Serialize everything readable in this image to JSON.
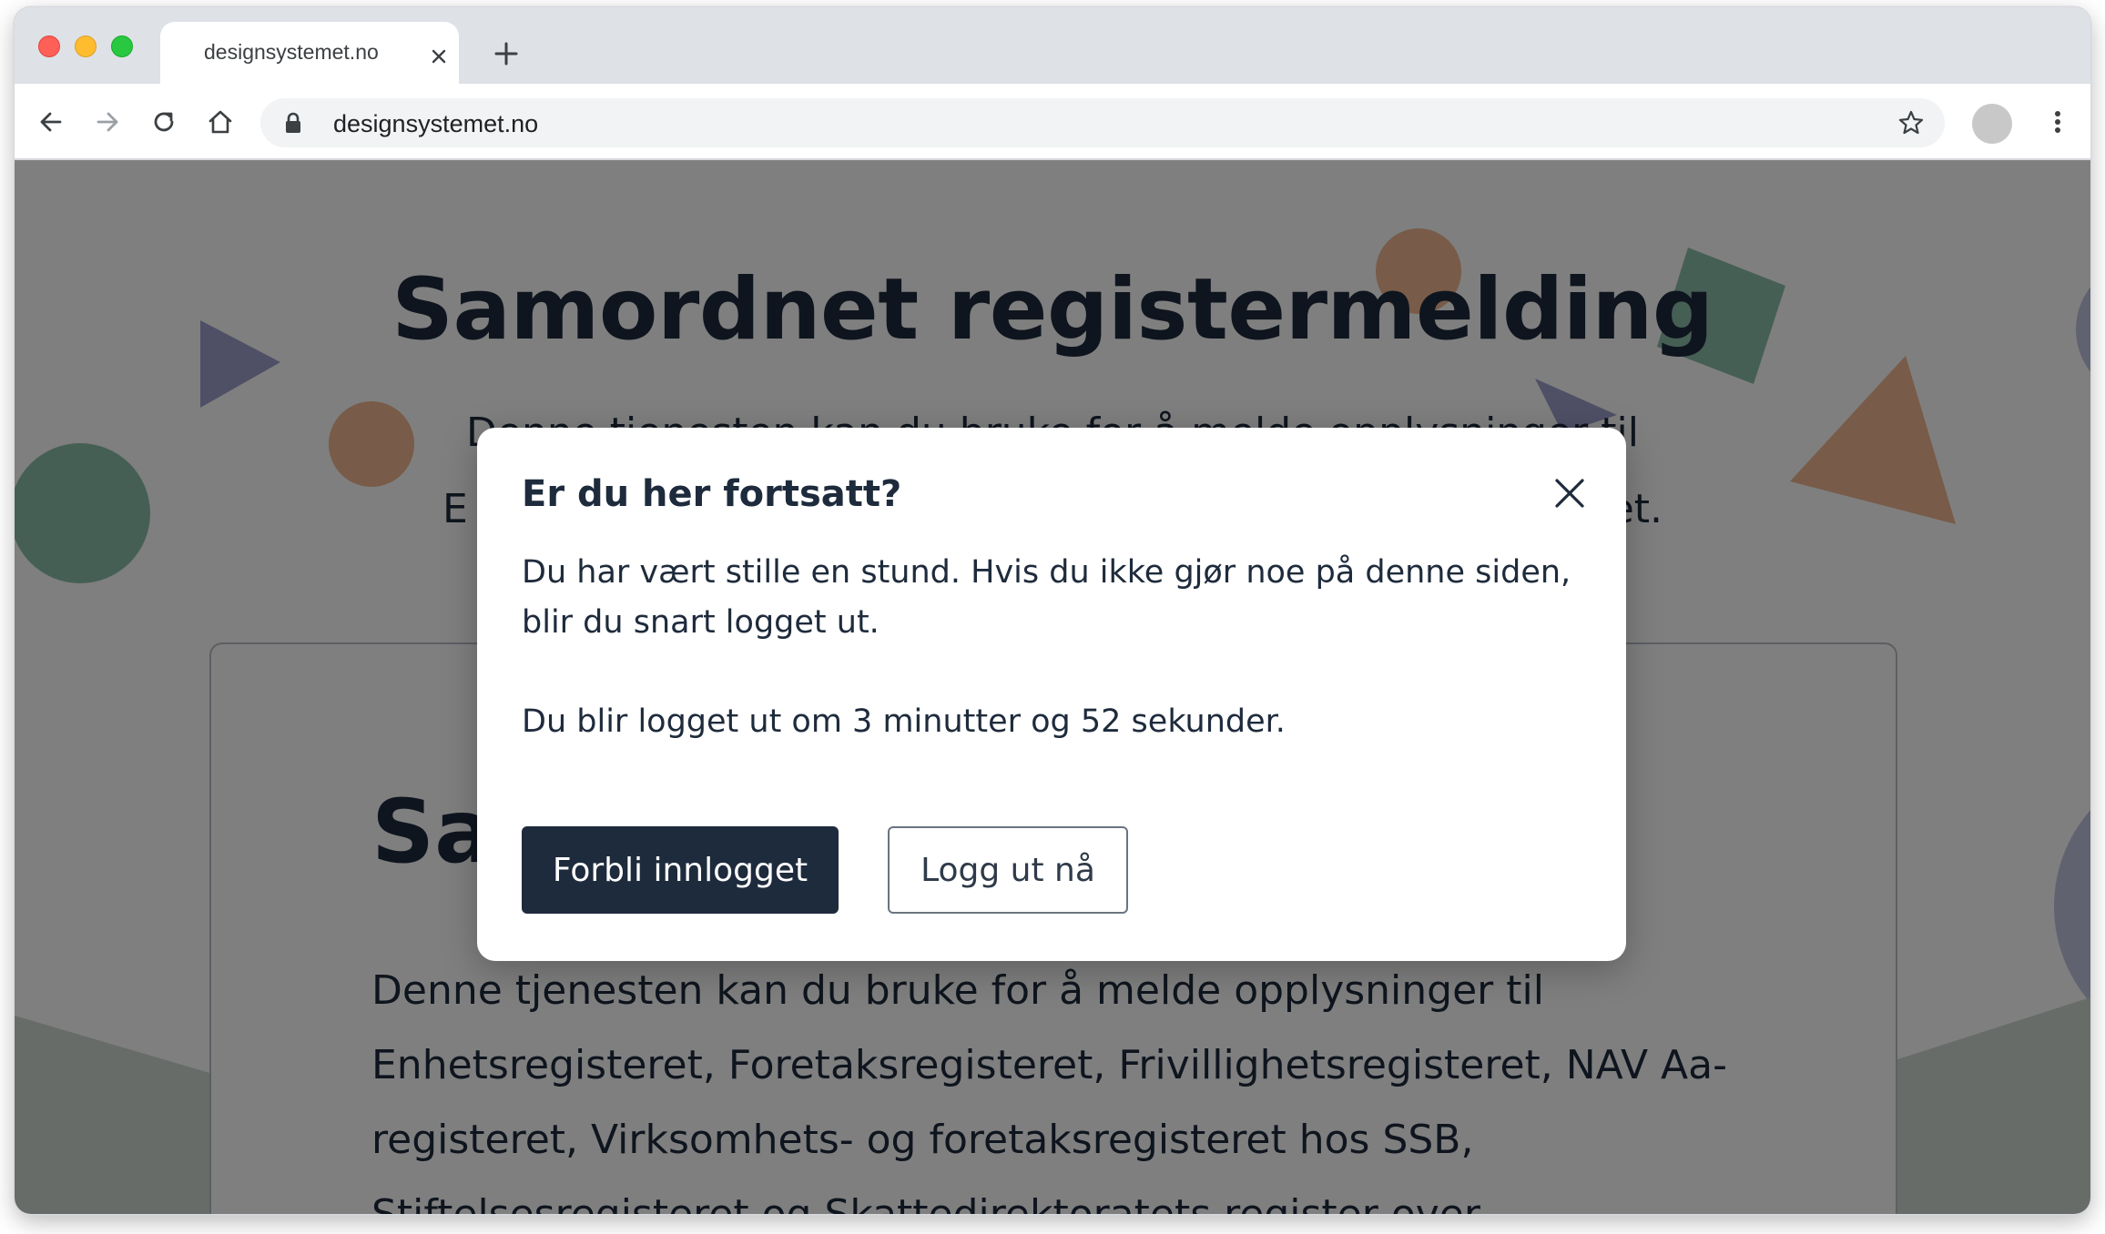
{
  "browser": {
    "tab_title": "designsystemet.no",
    "url": "designsystemet.no"
  },
  "page": {
    "hero_title": "Samordnet registermelding",
    "hero_subtitle_line1": "Denne tjenesten kan du bruke for å melde opplysninger til",
    "hero_subtitle_line2_start": "E",
    "hero_subtitle_line2_end": "et.",
    "card_title": "Sa",
    "card_body": "Denne tjenesten kan du bruke for å melde opplysninger til Enhetsregisteret, Foretaksregisteret, Frivillighetsregisteret, NAV Aa-registeret, Virksomhets- og foretaksregisteret hos SSB, Stiftelsesregisteret og Skattedirektoratets register over"
  },
  "modal": {
    "title": "Er du her fortsatt?",
    "text": "Du har vært stille en stund. Hvis du ikke gjør noe på denne siden, blir du snart logget ut.",
    "countdown": "Du blir logget ut om 3 minutter og 52 sekunder.",
    "primary_button": "Forbli innlogget",
    "secondary_button": "Logg ut nå"
  },
  "colors": {
    "primary": "#1e2b3c",
    "backdrop": "rgba(0,0,0,0.5)"
  }
}
